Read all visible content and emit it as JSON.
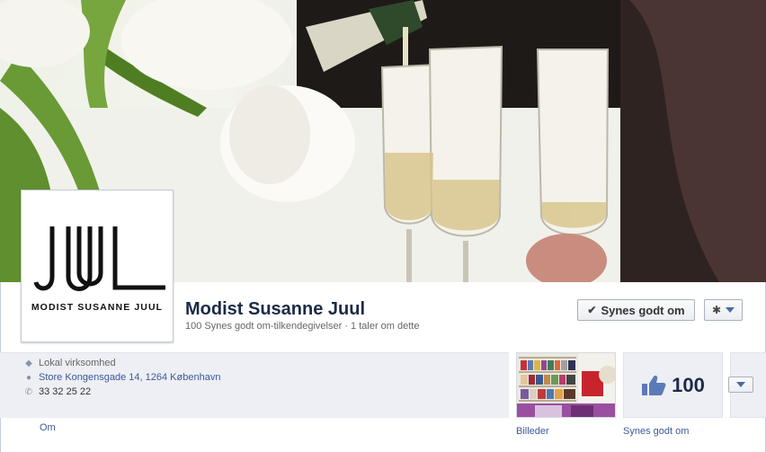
{
  "page": {
    "title": "Modist Susanne Juul",
    "subtitle": "100 Synes godt om-tilkendegivelser · 1 taler om dette",
    "logo_caption": "MODIST SUSANNE JUUL"
  },
  "actions": {
    "like_label": "Synes godt om",
    "like_icon": "check-icon",
    "settings_icon": "gear-icon"
  },
  "about": {
    "category": "Lokal virksomhed",
    "address": "Store Kongensgade 14, 1264 København",
    "phone": "33 32 25 22",
    "link_label": "Om"
  },
  "apps": {
    "photos_label": "Billeder",
    "likes_count": "100",
    "likes_label": "Synes godt om"
  },
  "colors": {
    "link_blue": "#3b5998",
    "title_navy": "#1c2a47",
    "panel_bg": "#edeff4"
  }
}
